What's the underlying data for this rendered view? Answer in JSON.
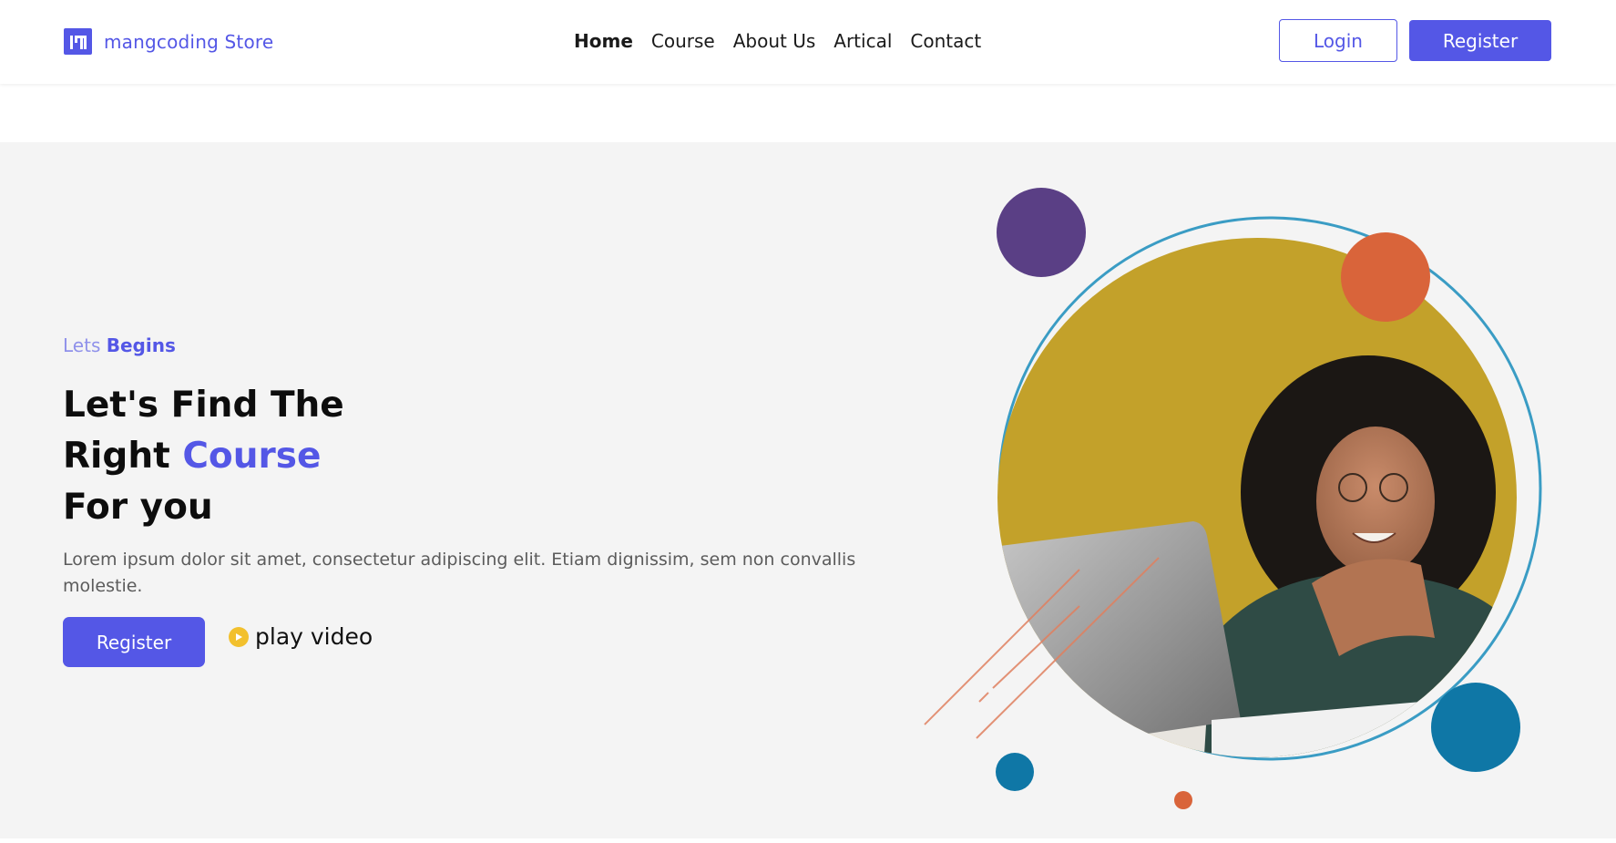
{
  "header": {
    "brand_name": "mangcoding Store",
    "logo_icon": "brand-logo-icon",
    "nav": [
      {
        "label": "Home",
        "active": true
      },
      {
        "label": "Course",
        "active": false
      },
      {
        "label": "About Us",
        "active": false
      },
      {
        "label": "Artical",
        "active": false
      },
      {
        "label": "Contact",
        "active": false
      }
    ],
    "login_label": "Login",
    "register_label": "Register"
  },
  "hero": {
    "tagline_light": "Lets",
    "tagline_strong": "Begins",
    "headline_line1": "Let's Find The",
    "headline_line2_prefix": "Right",
    "headline_line2_accent": "Course",
    "headline_line3": "For you",
    "description": "Lorem ipsum dolor sit amet, consectetur adipiscing elit. Etiam dignissim, sem non convallis molestie.",
    "register_label": "Register",
    "play_label": "play video",
    "play_icon": "play-icon"
  },
  "colors": {
    "brand": "#5457e6",
    "hero_bg": "#f4f4f4",
    "play_yellow": "#f2c02d",
    "circle_gold": "#c3a12a",
    "circle_purple": "#5a3f85",
    "circle_orange": "#d9643a",
    "circle_blue": "#0f77a6"
  }
}
